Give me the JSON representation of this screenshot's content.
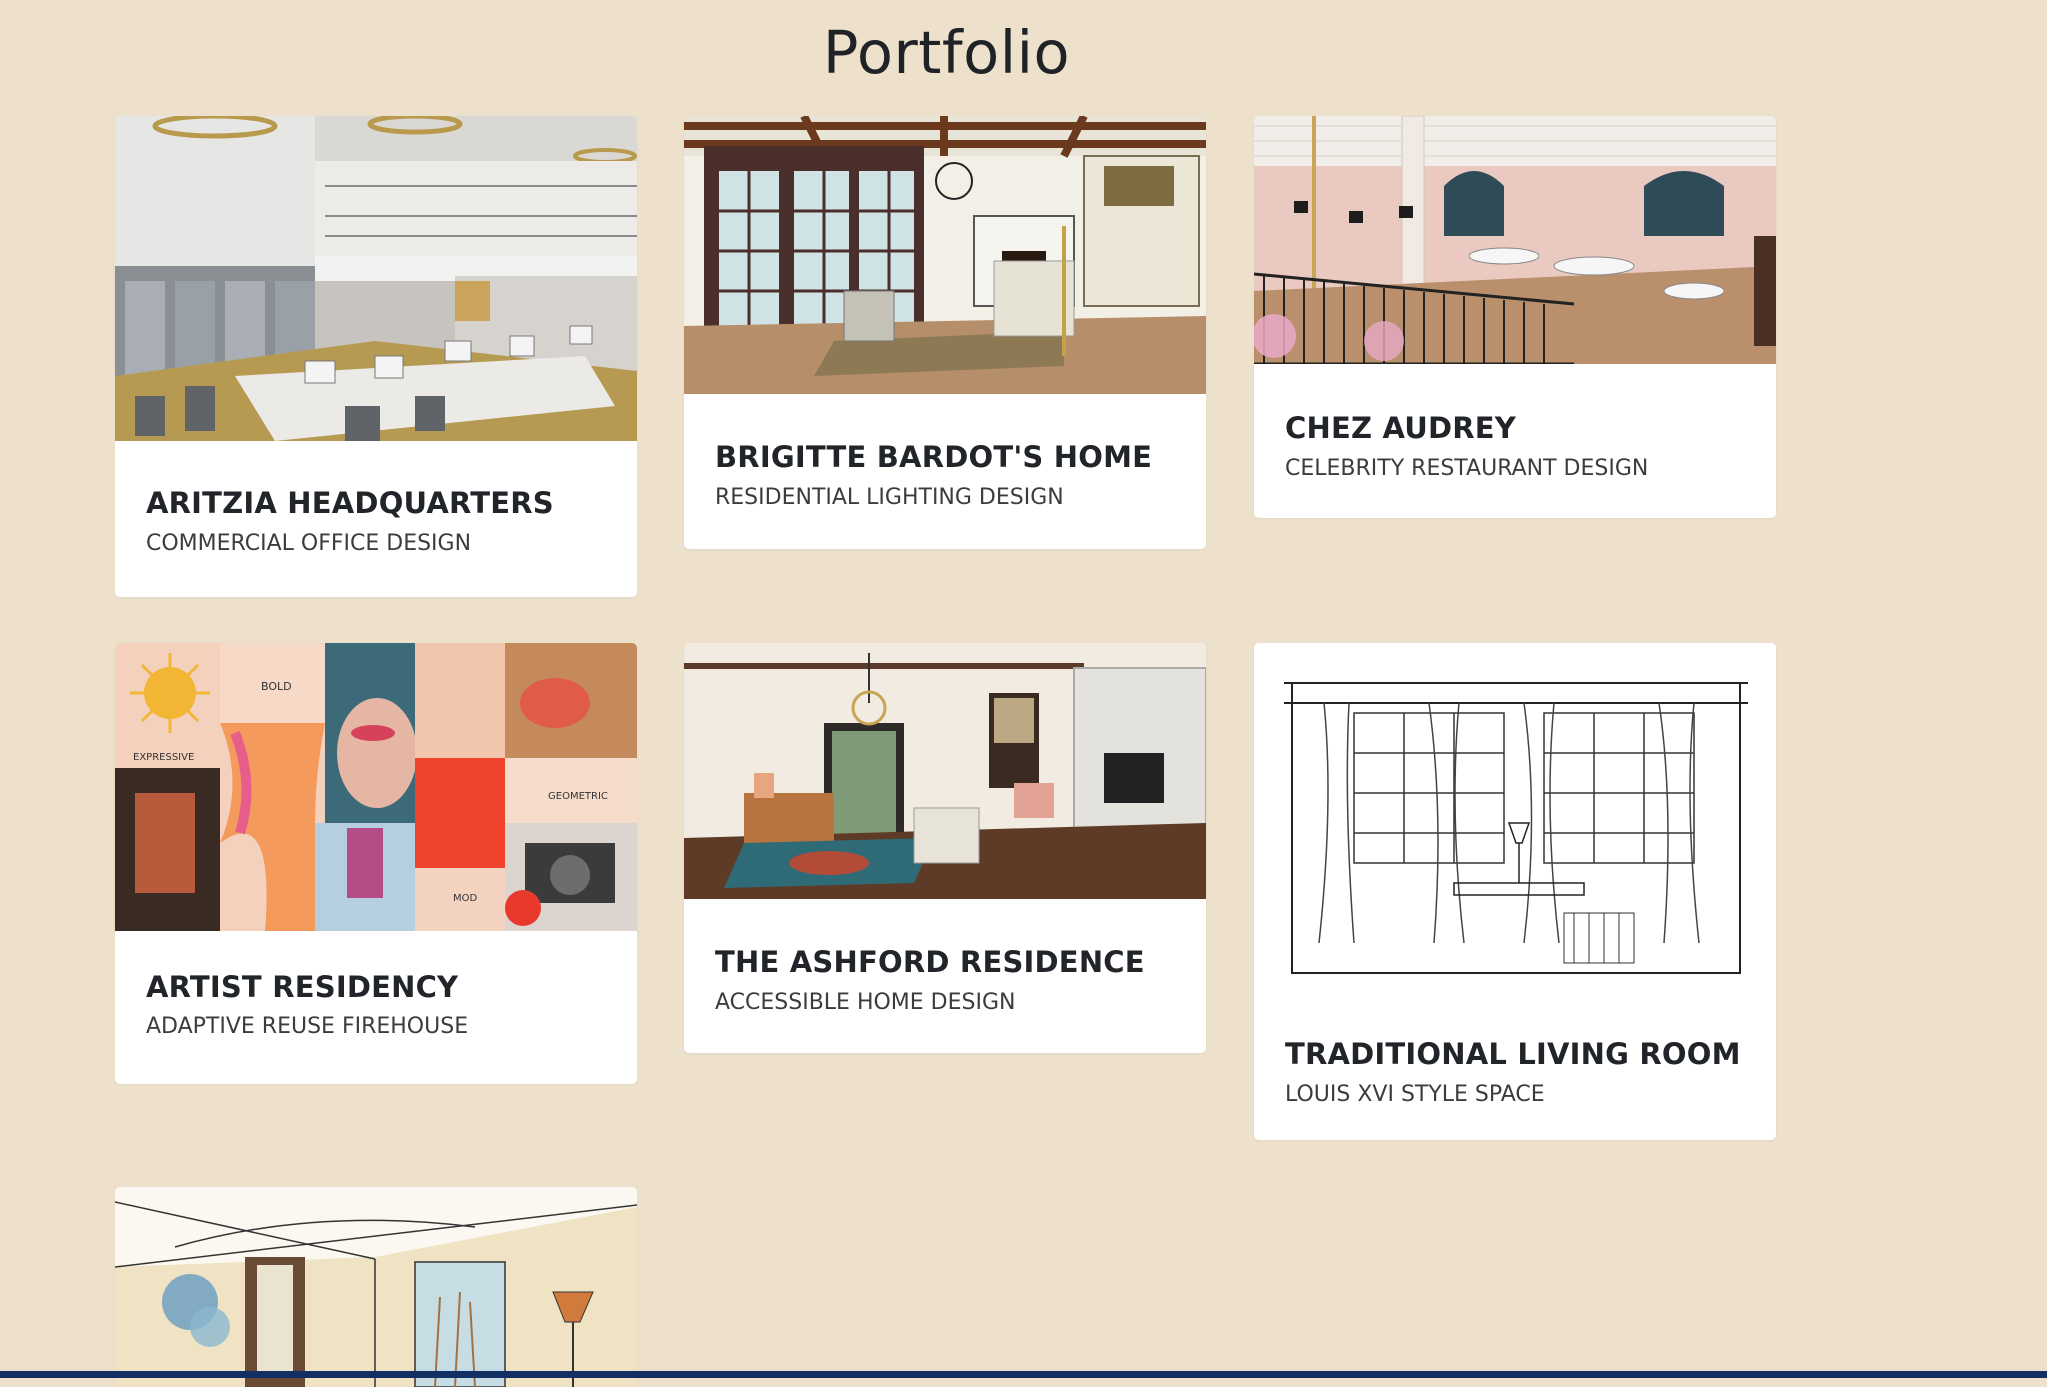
{
  "page": {
    "title": "Portfolio"
  },
  "cards": [
    {
      "title": "ARITZIA HEADQUARTERS",
      "subtitle": "COMMERCIAL OFFICE DESIGN",
      "image": "office-rendering"
    },
    {
      "title": "BRIGITTE BARDOT'S HOME",
      "subtitle": "RESIDENTIAL LIGHTING DESIGN",
      "image": "living-room-fireplace-rendering"
    },
    {
      "title": "CHEZ AUDREY",
      "subtitle": "CELEBRITY RESTAURANT DESIGN",
      "image": "restaurant-rendering"
    },
    {
      "title": "ARTIST RESIDENCY",
      "subtitle": "ADAPTIVE REUSE FIREHOUSE",
      "image": "mood-board-collage",
      "collage_labels": [
        "BOLD",
        "EXPRESSIVE",
        "GEOMETRIC",
        "MOD"
      ]
    },
    {
      "title": "THE ASHFORD RESIDENCE",
      "subtitle": "ACCESSIBLE HOME DESIGN",
      "image": "family-room-rendering"
    },
    {
      "title": "TRADITIONAL LIVING ROOM",
      "subtitle": "LOUIS XVI STYLE SPACE",
      "image": "window-elevation-sketch"
    },
    {
      "title": "",
      "subtitle": "",
      "image": "watercolor-interior-sketch"
    }
  ],
  "colors": {
    "page_background": "#ede1cc",
    "card_background": "#ffffff",
    "title_text": "#212529",
    "bottom_bar": "#123063"
  }
}
